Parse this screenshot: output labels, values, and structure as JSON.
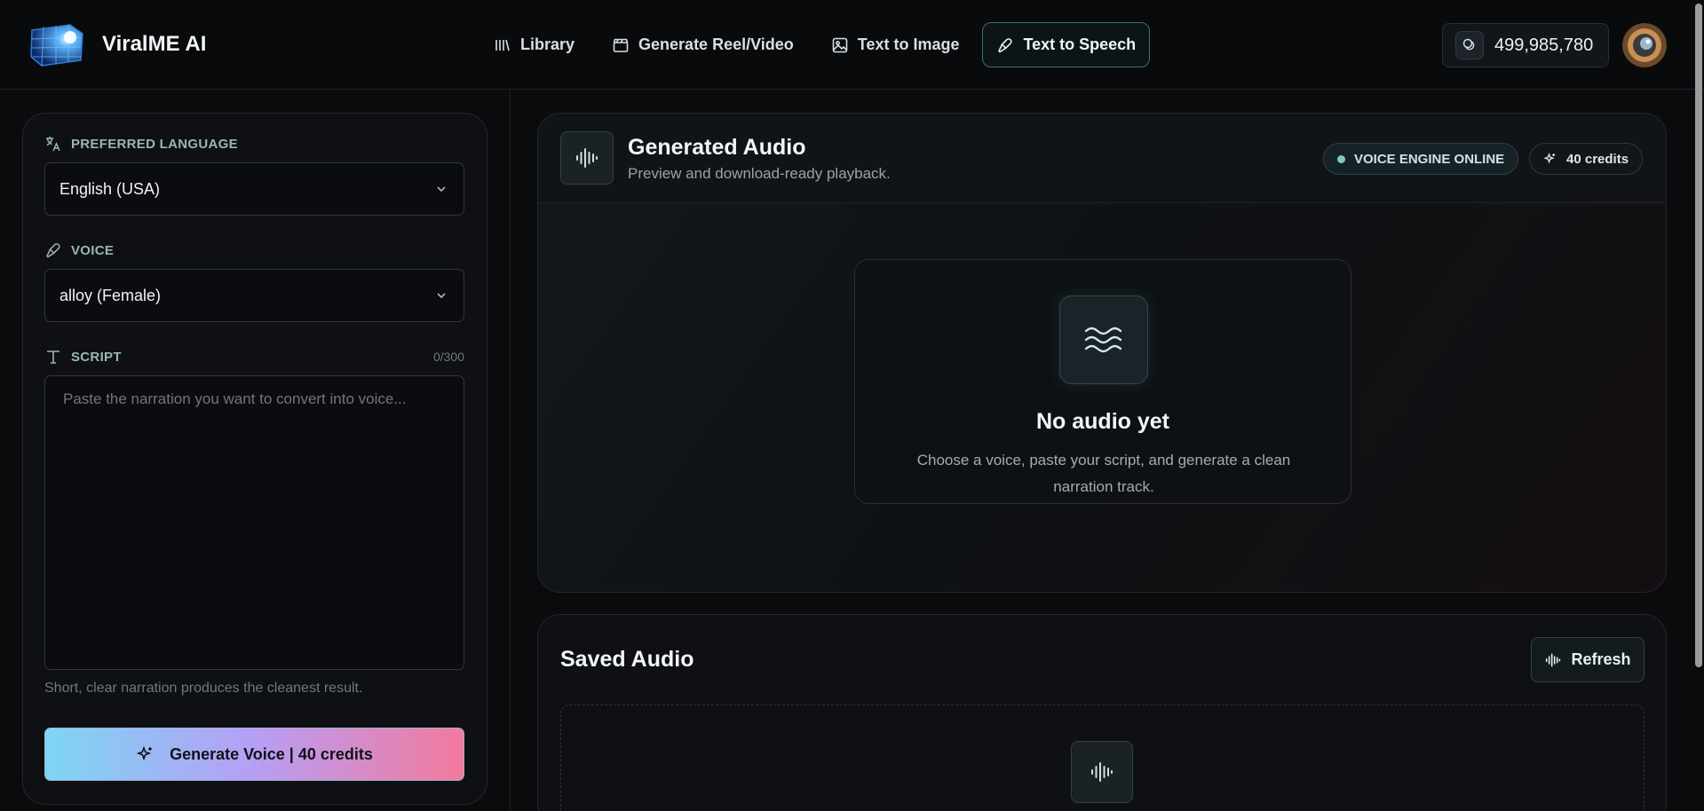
{
  "app": {
    "name": "ViralME AI"
  },
  "nav": {
    "items": [
      {
        "label": "Library",
        "icon": "library-icon",
        "active": false
      },
      {
        "label": "Generate Reel/Video",
        "icon": "clapperboard-icon",
        "active": false
      },
      {
        "label": "Text to Image",
        "icon": "image-icon",
        "active": false
      },
      {
        "label": "Text to Speech",
        "icon": "microphone-icon",
        "active": true
      }
    ]
  },
  "account": {
    "credits": "499,985,780"
  },
  "form": {
    "language": {
      "label": "PREFERRED LANGUAGE",
      "value": "English (USA)"
    },
    "voice": {
      "label": "VOICE",
      "value": "alloy (Female)"
    },
    "script": {
      "label": "SCRIPT",
      "count": "0/300",
      "placeholder": "Paste the narration you want to convert into voice...",
      "value": ""
    },
    "hint": "Short, clear narration produces the cleanest result.",
    "generate_label": "Generate Voice | 40 credits"
  },
  "generated": {
    "title": "Generated Audio",
    "subtitle": "Preview and download-ready playback.",
    "engine_status": "VOICE ENGINE ONLINE",
    "cost": "40 credits",
    "empty_title": "No audio yet",
    "empty_desc": "Choose a voice, paste your script, and generate a clean narration track."
  },
  "saved": {
    "title": "Saved Audio",
    "refresh_label": "Refresh"
  },
  "colors": {
    "accent": "#7fc9c9",
    "gradient_start": "#7dd6f4",
    "gradient_mid": "#b79ef5",
    "gradient_end": "#f27a9c"
  }
}
